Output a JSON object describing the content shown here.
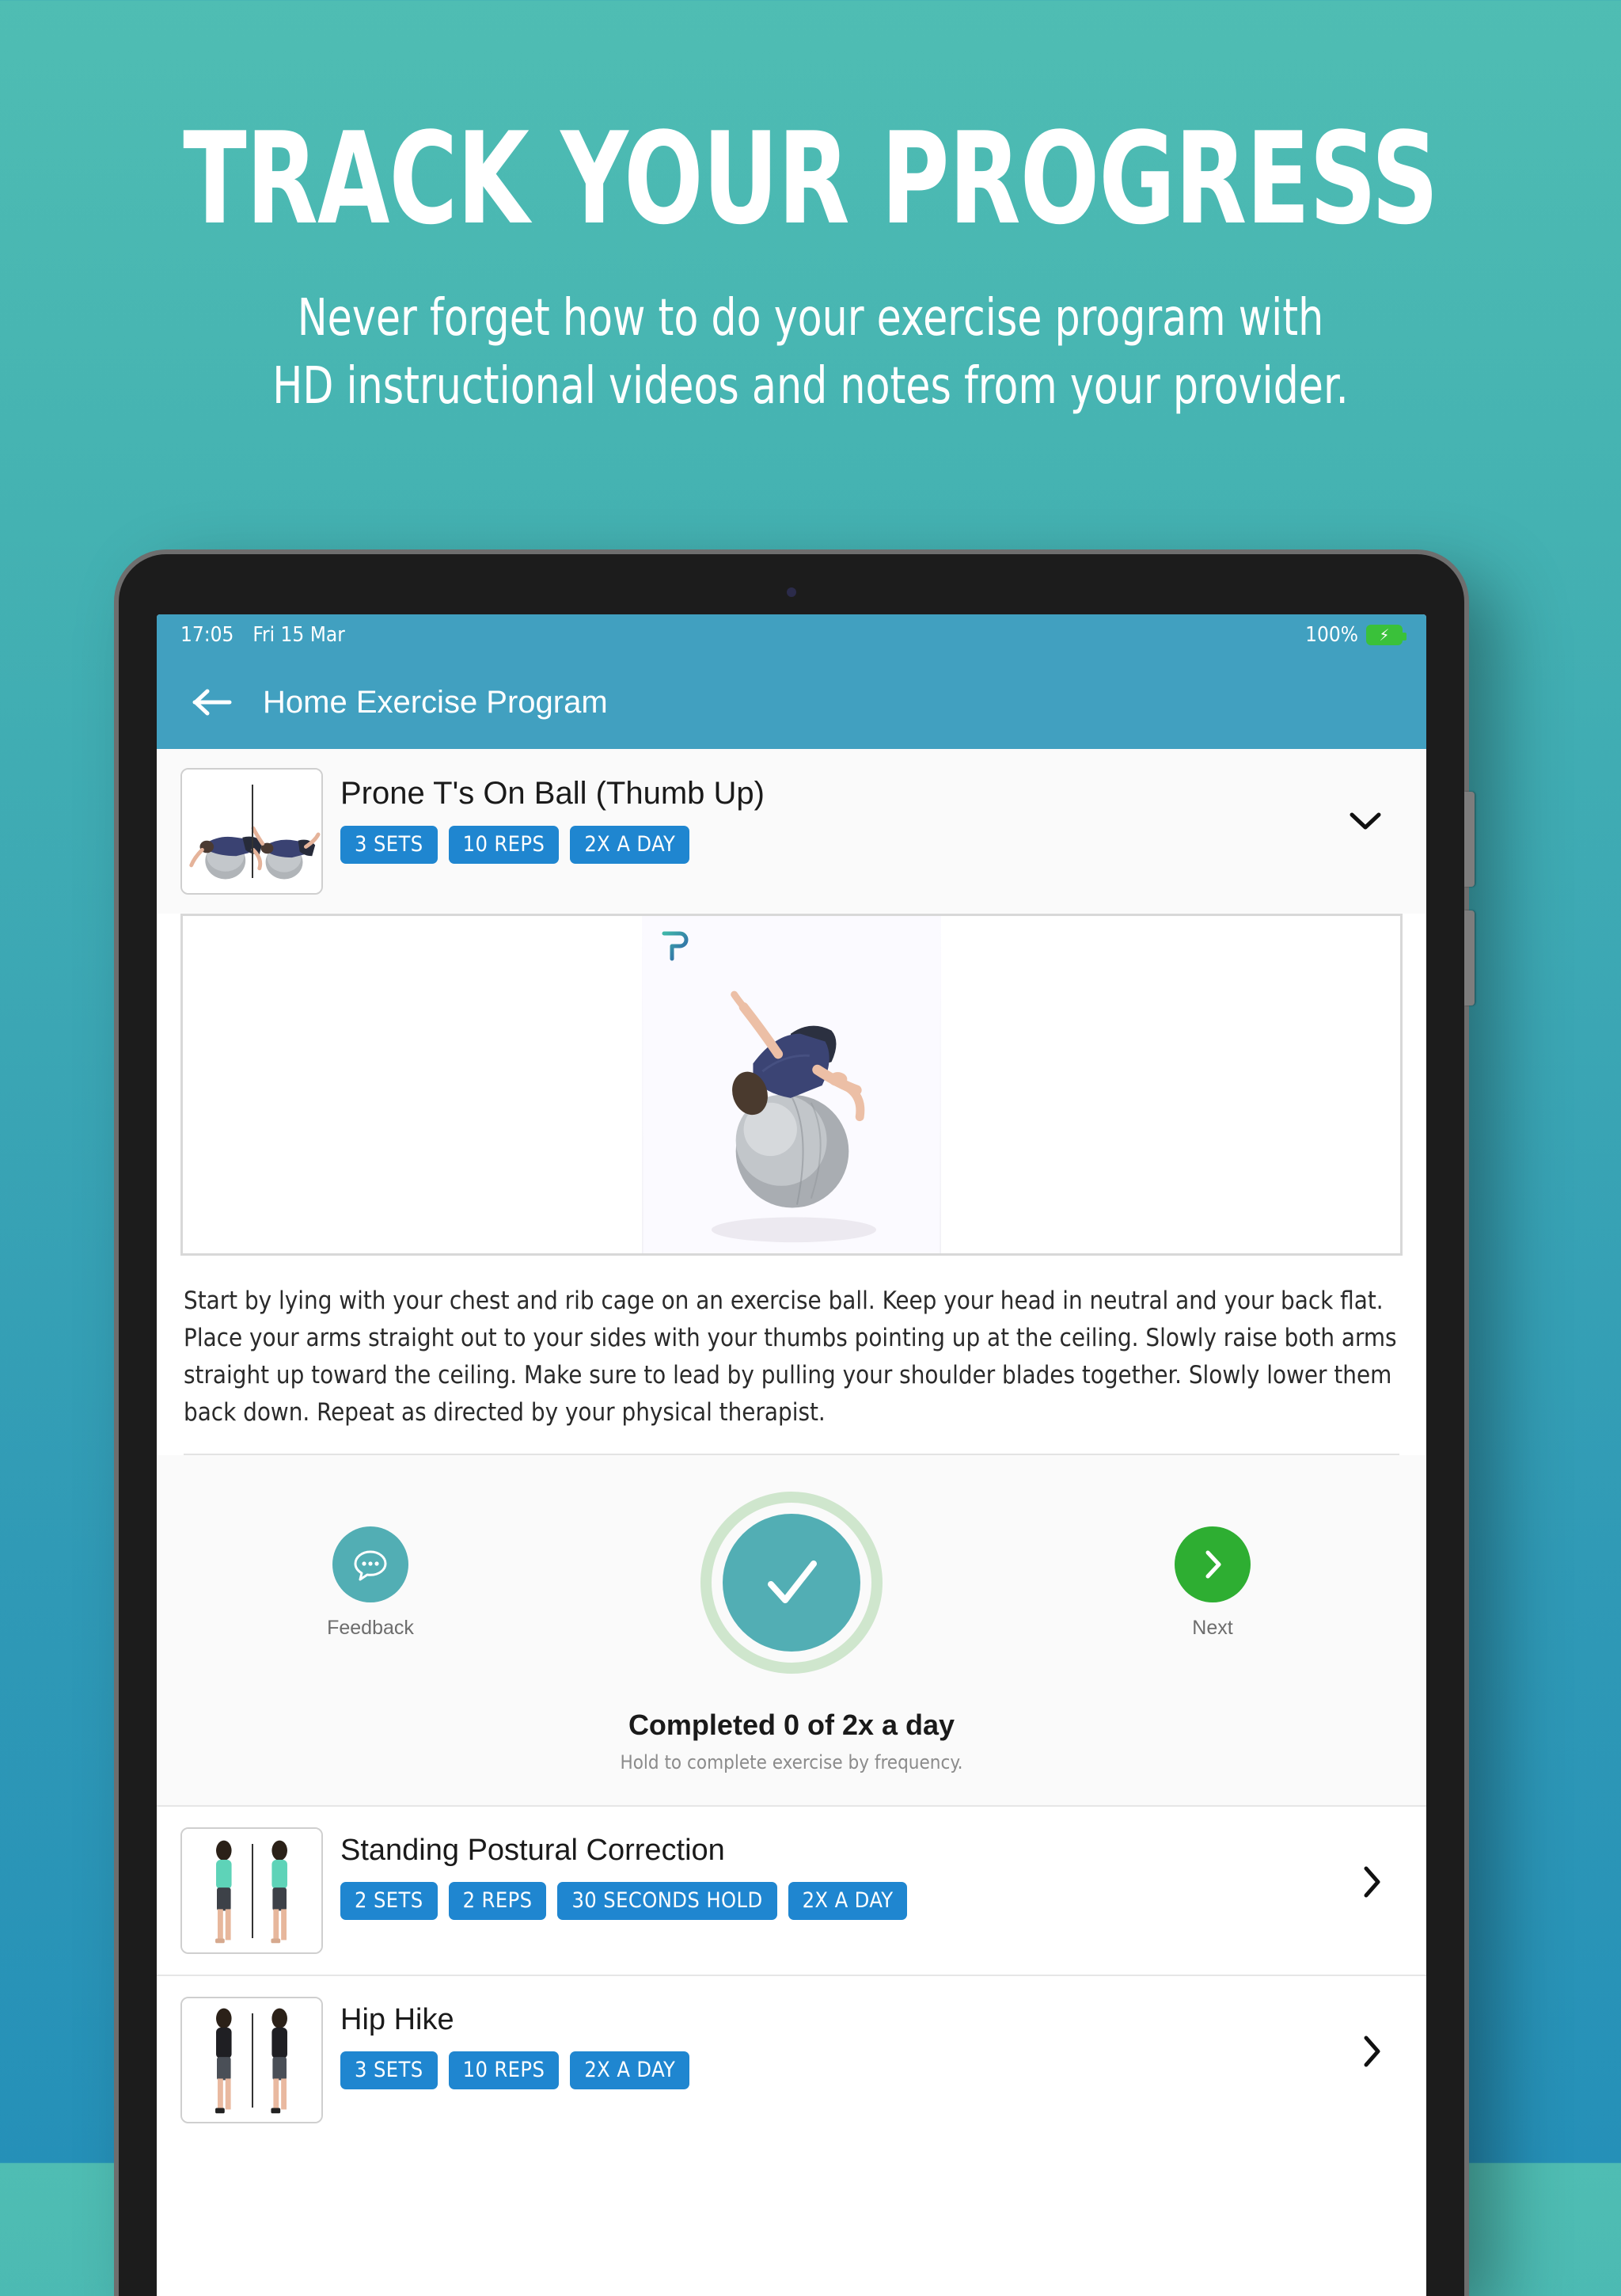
{
  "promo": {
    "title": "TRACK YOUR PROGRESS",
    "subtitle_line1": "Never forget how to do your exercise program with",
    "subtitle_line2": "HD instructional videos and notes from your provider."
  },
  "colors": {
    "bg_top": "#4FBDB3",
    "bg_bottom": "#2590B8",
    "header_blue": "#41A0C0",
    "tag_blue": "#1F86D0",
    "teal_accent": "#52AEB4",
    "next_green": "#2EAE32",
    "ring_green": "#CFE6CD"
  },
  "status_bar": {
    "time": "17:05",
    "date": "Fri 15 Mar",
    "battery_percent": "100%",
    "battery_icon": "battery-charging-icon"
  },
  "app_header": {
    "back_icon": "arrow-left-icon",
    "title": "Home Exercise Program"
  },
  "expanded_exercise": {
    "thumbnail_icon": "exercise-thumbnail-prone-t",
    "title": "Prone T's On Ball (Thumb Up)",
    "tags": [
      "3 SETS",
      "10 REPS",
      "2X A DAY"
    ],
    "collapse_icon": "chevron-down-icon",
    "video": {
      "watermark_icon": "physitrack-p-logo",
      "frame_alt": "Person lying prone on silver exercise ball with arms extended"
    },
    "description": "Start by lying with your chest and rib cage on an exercise ball. Keep your head in neutral and your back flat. Place your arms straight out to your sides with your thumbs pointing up at the ceiling. Slowly raise both arms straight up toward the ceiling. Make sure to lead by pulling your shoulder blades together. Slowly lower them back down. Repeat as directed by your physical therapist.",
    "actions": {
      "feedback_icon": "chat-bubble-dots-icon",
      "feedback_label": "Feedback",
      "complete_icon": "check-icon",
      "next_icon": "chevron-right-icon",
      "next_label": "Next",
      "completed_text": "Completed 0 of 2x a day",
      "hold_hint": "Hold to complete exercise by frequency."
    }
  },
  "exercise_list": [
    {
      "thumbnail_icon": "exercise-thumbnail-standing-postural",
      "title": "Standing Postural Correction",
      "tags": [
        "2 SETS",
        "2 REPS",
        "30 SECONDS HOLD",
        "2X A DAY"
      ],
      "expand_icon": "chevron-right-icon"
    },
    {
      "thumbnail_icon": "exercise-thumbnail-hip-hike",
      "title": "Hip Hike",
      "tags": [
        "3 SETS",
        "10 REPS",
        "2X A DAY"
      ],
      "expand_icon": "chevron-right-icon"
    }
  ]
}
